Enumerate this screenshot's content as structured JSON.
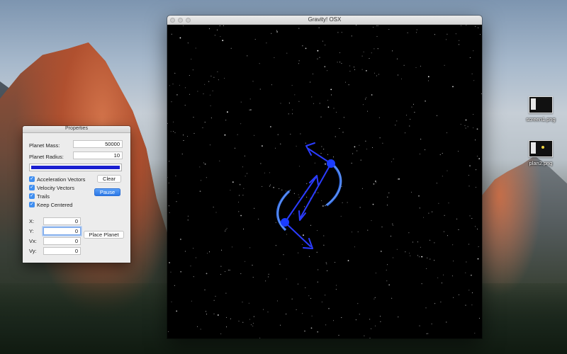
{
  "desktop": {
    "icons": [
      {
        "label": "screen1.png",
        "icon": "png-file-icon"
      },
      {
        "label": "plan2.png",
        "icon": "png-file-icon"
      }
    ]
  },
  "main_window": {
    "title": "Gravity! OSX"
  },
  "simulation": {
    "background_color": "#000000",
    "planet_color": "#1a3cff",
    "trail_color": "#3c7bff",
    "vector_color": "#2b3cff"
  },
  "properties_panel": {
    "title": "Properties",
    "planet_mass": {
      "label": "Planet Mass:",
      "value": "50000"
    },
    "planet_radius": {
      "label": "Planet Radius:",
      "value": "10"
    },
    "planet_color": "#1a1fd0",
    "checkboxes": [
      {
        "label": "Acceleration Vectors",
        "checked": true
      },
      {
        "label": "Velocity Vectors",
        "checked": true
      },
      {
        "label": "Trails",
        "checked": true
      },
      {
        "label": "Keep Centered",
        "checked": true
      }
    ],
    "clear_button": "Clear",
    "pause_button": "Pause",
    "x": {
      "label": "X:",
      "value": "0"
    },
    "y": {
      "label": "Y:",
      "value": "0"
    },
    "vx": {
      "label": "Vx:",
      "value": "0"
    },
    "vy": {
      "label": "Vy:",
      "value": "0"
    },
    "place_planet_button": "Place Planet"
  }
}
